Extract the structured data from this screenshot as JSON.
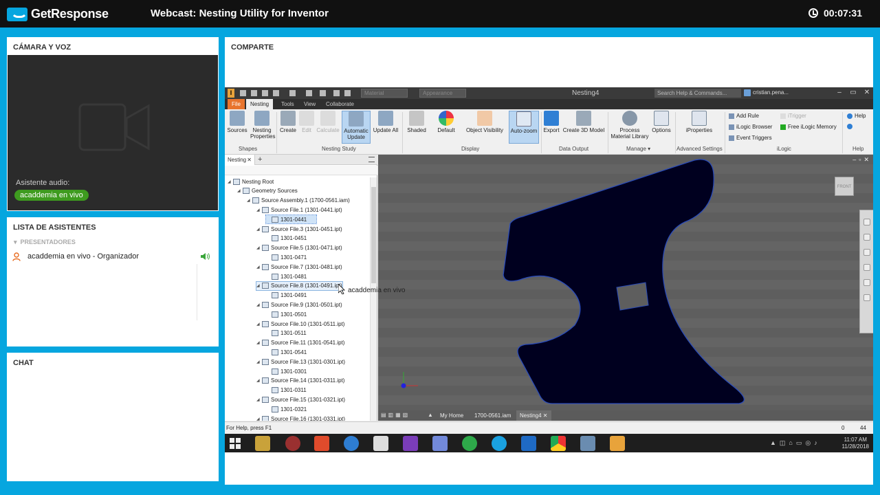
{
  "header": {
    "brand": "GetResponse",
    "title": "Webcast: Nesting Utility for Inventor",
    "timer": "00:07:31"
  },
  "camera": {
    "title": "CÁMARA Y VOZ",
    "audio_label": "Asistente audio:",
    "audio_user": "acaddemia en vivo"
  },
  "attendees": {
    "title": "LISTA DE ASISTENTES",
    "presenters_header": "PRESENTADORES",
    "presenter": "acaddemia en vivo  - Organizador"
  },
  "chat": {
    "title": "CHAT"
  },
  "share": {
    "title": "COMPARTE",
    "cursor_label": "acaddemia en vivo"
  },
  "inventor": {
    "qat_material": "Material",
    "qat_appearance": "Appearance",
    "doc_title": "Nesting4",
    "help_search": "Search Help & Commands...",
    "user": "cristian.pena...",
    "tabs": [
      "File",
      "Nesting",
      "Tools",
      "View",
      "Collaborate"
    ],
    "ribbon": {
      "sources": "Sources",
      "nesting_properties_1": "Nesting",
      "nesting_properties_2": "Properties",
      "create": "Create",
      "edit": "Edit",
      "calculate": "Calculate",
      "automatic_update_1": "Automatic",
      "automatic_update_2": "Update",
      "update_all": "Update All",
      "shaded": "Shaded",
      "default": "Default",
      "object_visibility": "Object Visibility",
      "auto_zoom": "Auto-zoom",
      "export": "Export",
      "create_3d_model": "Create 3D Model",
      "process_1": "Process",
      "process_2": "Material Library",
      "options": "Options",
      "iproperties": "iProperties",
      "add_rule": "Add Rule",
      "itrigger": "iTrigger",
      "ilogic_browser": "iLogic Browser",
      "free_ilogic_memory": "Free iLogic Memory",
      "event_triggers": "Event Triggers",
      "help": "Help",
      "groups": {
        "shapes": "Shapes",
        "nesting_study": "Nesting Study",
        "display": "Display",
        "data_output": "Data Output",
        "manage": "Manage ▾",
        "advanced_settings": "Advanced Settings",
        "ilogic": "iLogic",
        "help": "Help"
      }
    },
    "browser": {
      "tab": "Nesting",
      "tree": [
        {
          "text": "Nesting Root",
          "level": 0
        },
        {
          "text": "Geometry Sources",
          "level": 1
        },
        {
          "text": "Source Assembly.1 (1700-0561.iam)",
          "level": 2
        },
        {
          "text": "Source File.1 (1301-0441.ipt)",
          "level": 3
        },
        {
          "text": "1301-0441",
          "level": 4
        },
        {
          "text": "Source File.3 (1301-0451.ipt)",
          "level": 3
        },
        {
          "text": "1301-0451",
          "level": 4
        },
        {
          "text": "Source File.5 (1301-0471.ipt)",
          "level": 3
        },
        {
          "text": "1301-0471",
          "level": 4
        },
        {
          "text": "Source File.7 (1301-0481.ipt)",
          "level": 3
        },
        {
          "text": "1301-0481",
          "level": 4
        },
        {
          "text": "Source File.8 (1301-0491.ipt)",
          "level": 3
        },
        {
          "text": "1301-0491",
          "level": 4
        },
        {
          "text": "Source File.9 (1301-0501.ipt)",
          "level": 3
        },
        {
          "text": "1301-0501",
          "level": 4
        },
        {
          "text": "Source File.10 (1301-0511.ipt)",
          "level": 3
        },
        {
          "text": "1301-0511",
          "level": 4
        },
        {
          "text": "Source File.11 (1301-0541.ipt)",
          "level": 3
        },
        {
          "text": "1301-0541",
          "level": 4
        },
        {
          "text": "Source File.13 (1301-0301.ipt)",
          "level": 3
        },
        {
          "text": "1301-0301",
          "level": 4
        },
        {
          "text": "Source File.14 (1301-0311.ipt)",
          "level": 3
        },
        {
          "text": "1301-0311",
          "level": 4
        },
        {
          "text": "Source File.15 (1301-0321.ipt)",
          "level": 3
        },
        {
          "text": "1301-0321",
          "level": 4
        },
        {
          "text": "Source File.16 (1301-0331.ipt)",
          "level": 3
        }
      ]
    },
    "viewcube": "FRONT",
    "doc_tabs": [
      "My Home",
      "1700-0561.iam",
      "Nesting4"
    ],
    "status": {
      "help": "For Help, press F1",
      "n1": "0",
      "n2": "44"
    },
    "taskbar": {
      "time": "11:07 AM",
      "date": "11/28/2018"
    },
    "colors": {
      "part_fill": "#00001f",
      "part_edge": "#2a4bb8",
      "viewport_bg": "#5e5e5e",
      "file_tab": "#e8742d"
    }
  }
}
